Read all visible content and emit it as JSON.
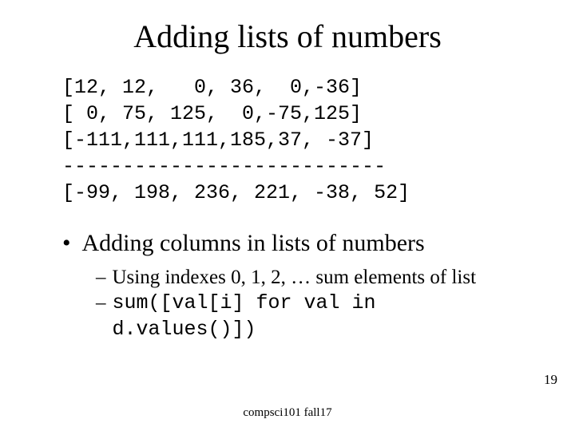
{
  "title": "Adding lists of numbers",
  "code": {
    "line1": "[12, 12,   0, 36,  0,-36]",
    "line2": "[ 0, 75, 125,  0,-75,125]",
    "line3": "[-111,111,111,185,37, -37]",
    "line4": "---------------------------",
    "line5": "[-99, 198, 236, 221, -38, 52]"
  },
  "bullets": {
    "l1": "Adding columns in lists of numbers",
    "l2a": "Using indexes 0, 1, 2, … sum elements of list",
    "l2b": "sum([val[i] for val in d.values()])"
  },
  "page_number": "19",
  "footer": "compsci101 fall17"
}
